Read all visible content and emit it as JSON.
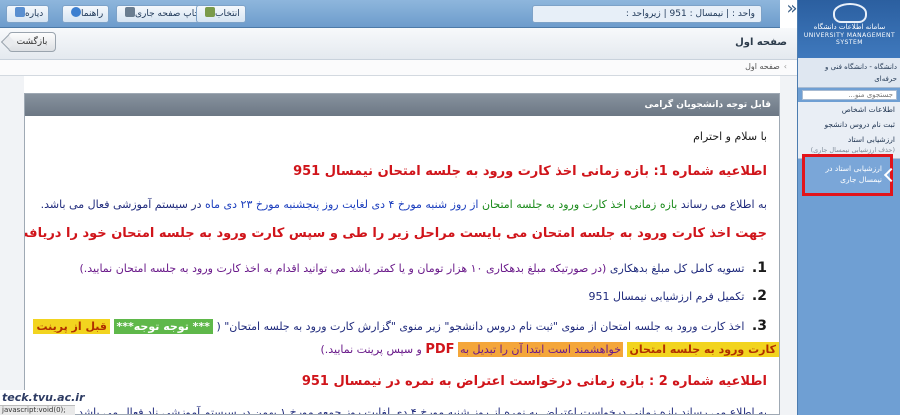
{
  "toolbar": {
    "items": [
      {
        "label": "دیاره"
      },
      {
        "label": "راهنما"
      },
      {
        "label": "چاپ صفحه جاری"
      },
      {
        "label": "انتخاب"
      }
    ],
    "status": "واحد : | نیمسال : 951 | زیرواحد :",
    "colors": {
      "accent": "#6d9ccc"
    }
  },
  "header": {
    "back_label": "بازگشت",
    "page_title": "صفحه اول",
    "breadcrumb": "صفحه اول"
  },
  "panel": {
    "title": "قابل توجه دانشجویان گرامی",
    "greeting": "با سلام و احترام",
    "notice1_title": "اطلاعیه شماره 1: بازه زمانی اخذ کارت ورود به جلسه امتحان نیمسال 951",
    "notice1_line1_a": "به اطلاع می رساند",
    "notice1_line1_b": "بازه زمانی اخذ کارت ورود به جلسه امتحان",
    "notice1_line1_c": "از روز شنبه مورخ ۴ دی لغایت روز پنجشنبه مورخ ۲۳ دی ماه",
    "notice1_line1_d": "در سیستم آموزشی فعال می باشد.",
    "steps_title": "جهت اخذ کارت ورود به جلسه امتحان می بایست مراحل زیر را طی و سپس کارت ورود به جلسه امتحان خود را دریافت نمایید:",
    "steps": [
      {
        "num": "1.",
        "text": "تسویه کامل کل مبلغ بدهکاری",
        "note": "(در صورتیکه مبلغ بدهکاری ۱۰ هزار تومان و یا کمتر باشد می توانید اقدام به اخذ کارت ورود به جلسه امتحان نمایید.)"
      },
      {
        "num": "2.",
        "text": "تکمیل فرم ارزشیابی نیمسال 951"
      },
      {
        "num": "3.",
        "text": "اخذ کارت ورود به جلسه امتحان از منوی \"ثبت نام دروس دانشجو\" زیر منوی \"گزارش کارت ورود به جلسه امتحان\" (",
        "badge_green": "*** توجه توجه***",
        "badge_yellow": "قبل از پرینت"
      }
    ],
    "step3_line2_a": "کارت ورود به جلسه امتحان",
    "step3_line2_b": "خواهشمند است ابتدا آن را تبدیل به",
    "step3_line2_pdf": "PDF",
    "step3_line2_c": "و سپس پرینت نمایید.)",
    "notice2_title": "اطلاعیه شماره 2 : بازه زمانی درخواست اعتراض به نمره در نیمسال 951",
    "notice2_line1": "به اطلاع می رساند بازه زمانی درخواست اعتراض به نمره از روز شنبه مورخ ۴ دی لغایت روز جمعه مورخ ۱ بهمن در سیستم آموزشی ناد فعال می باشد."
  },
  "sidebar": {
    "logo_fa": "سامانه اطلاعات دانشگاه",
    "logo_en": "UNIVERSITY MANAGEMENT SYSTEM",
    "university": "دانشگاه - دانشگاه فنی و حرفه‌ای",
    "search_placeholder": "جستجوی منو...",
    "menu": [
      {
        "label": "اطلاعات اشخاص"
      },
      {
        "label": "ثبت نام دروس دانشجو"
      },
      {
        "label": "ارزشیابی استاد",
        "sub": "(حذف ارزشیابی نیمسال جاری)"
      }
    ],
    "active_item": "ارزشیابی استاد در نیمسال جاری"
  },
  "status": {
    "logo": "teck.tvu.ac.ir",
    "text": "javascript:void(0);"
  }
}
